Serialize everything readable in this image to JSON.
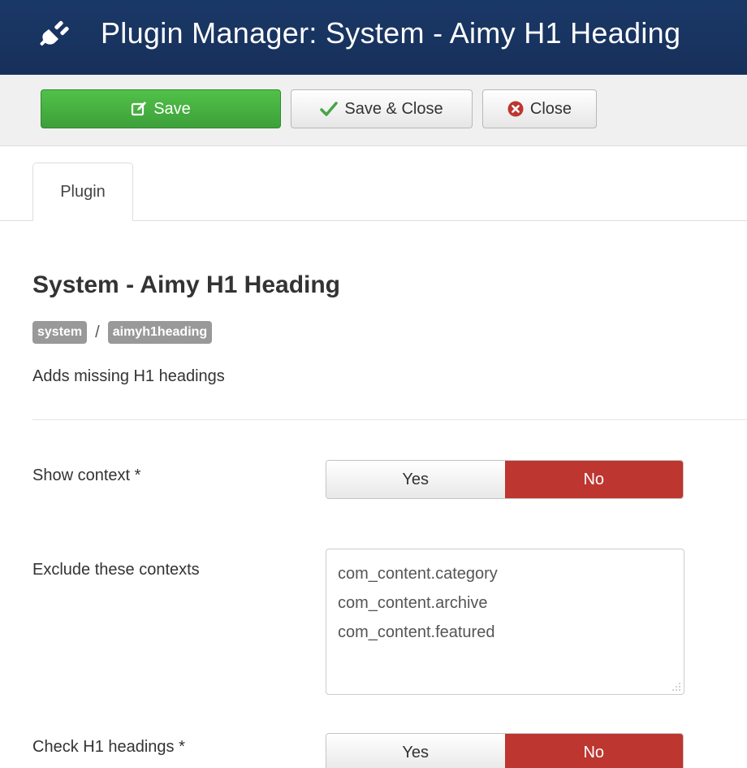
{
  "header": {
    "title": "Plugin Manager: System - Aimy H1 Heading",
    "icon": "plug-icon"
  },
  "toolbar": {
    "save_label": "Save",
    "save_close_label": "Save & Close",
    "close_label": "Close",
    "save_color": "#46a546",
    "close_icon_color": "#bd362f"
  },
  "tabs": [
    {
      "label": "Plugin",
      "active": true
    }
  ],
  "plugin": {
    "title": "System - Aimy H1 Heading",
    "folder_badge": "system",
    "separator": "/",
    "element_badge": "aimyh1heading",
    "description": "Adds missing H1 headings"
  },
  "fields": {
    "show_context": {
      "label": "Show context *",
      "yes_label": "Yes",
      "no_label": "No",
      "selected": "No"
    },
    "exclude_contexts": {
      "label": "Exclude these contexts",
      "lines": [
        "com_content.category",
        "com_content.archive",
        "com_content.featured"
      ]
    },
    "check_h1": {
      "label": "Check H1 headings *",
      "yes_label": "Yes",
      "no_label": "No",
      "selected": "No"
    }
  }
}
